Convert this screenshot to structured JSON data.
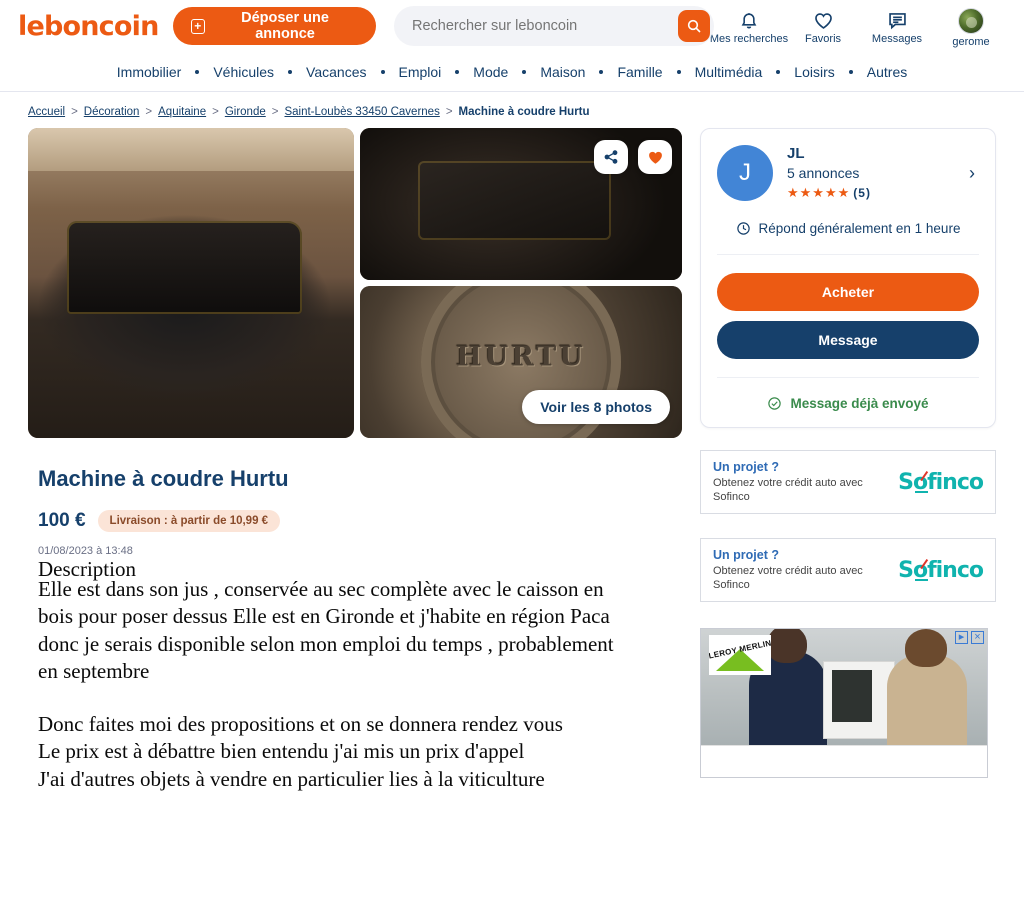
{
  "header": {
    "logo": "leboncoin",
    "deposit_label": "Déposer une annonce",
    "plus_icon": "plus-square-icon",
    "search": {
      "placeholder": "Rechercher sur leboncoin",
      "value": "",
      "icon": "search-icon"
    },
    "actions": [
      {
        "icon": "bell-icon",
        "label": "Mes recherches"
      },
      {
        "icon": "heart-icon",
        "label": "Favoris"
      },
      {
        "icon": "message-icon",
        "label": "Messages"
      },
      {
        "icon": "avatar-icon",
        "label": "gerome"
      }
    ]
  },
  "nav": {
    "items": [
      "Immobilier",
      "Véhicules",
      "Vacances",
      "Emploi",
      "Mode",
      "Maison",
      "Famille",
      "Multimédia",
      "Loisirs",
      "Autres"
    ]
  },
  "breadcrumb": {
    "links": [
      "Accueil",
      "Décoration",
      "Aquitaine",
      "Gironde",
      "Saint-Loubès 33450 Cavernes"
    ],
    "separator": ">",
    "current": "Machine à coudre Hurtu"
  },
  "gallery": {
    "share_icon": "share-icon",
    "favorite_icon": "heart-filled-icon",
    "see_photos_label": "Voir les 8 photos",
    "photos": [
      {
        "alt": "Machine à coudre ancienne Hurtu sur son caisson en bois"
      },
      {
        "alt": "Détail du mécanisme de la machine à coudre"
      },
      {
        "alt": "Plaque gravée HURTU sur la machine"
      }
    ],
    "badge_word": "HURTU"
  },
  "listing": {
    "title": "Machine à coudre Hurtu",
    "price": "100 €",
    "shipping_badge": "Livraison : à partir de 10,99 €",
    "date": "01/08/2023 à 13:48",
    "description_heading": "Description",
    "description_p1": "Elle est dans son jus , conservée au sec complète avec le caisson en\nbois pour poser dessus Elle est en Gironde et j'habite en région Paca\ndonc je serais disponible selon mon emploi du temps , probablement\nen septembre",
    "description_p2": "Donc faites moi des propositions et on se donnera rendez vous\nLe prix est à débattre bien entendu j'ai mis un prix d'appel\nJ'ai d'autres objets à vendre en particulier lies à la viticulture"
  },
  "seller": {
    "avatar_initial": "J",
    "name": "JL",
    "ads_count": "5 annonces",
    "stars": "★★★★★",
    "reviews_count": "(5)",
    "chevron_icon": "chevron-right-icon",
    "clock_icon": "clock-icon",
    "reply_time": "Répond généralement en 1 heure",
    "buy_label": "Acheter",
    "message_label": "Message",
    "check_icon": "check-circle-icon",
    "already_sent": "Message déjà envoyé"
  },
  "sofinco_ads": [
    {
      "title": "Un projet ?",
      "body": "Obtenez votre crédit auto avec Sofinco",
      "brand": "Sofinco"
    },
    {
      "title": "Un projet ?",
      "body": "Obtenez votre crédit auto avec Sofinco",
      "brand": "Sofinco"
    }
  ],
  "display_ad": {
    "brand": "LEROY MERLIN",
    "adchoices_icon": "adchoices-icon",
    "close_icon": "close-icon",
    "alt": "Deux hommes consultant une tablette devant une chaudière"
  },
  "colors": {
    "brand_orange": "#EC5A13",
    "brand_navy": "#16406B",
    "avatar_blue": "#4285D6",
    "success_green": "#3A8B4C",
    "shipping_badge_bg": "#FBE4D7",
    "sofinco_teal": "#10B3AE",
    "search_bg": "#F2F3F7"
  }
}
